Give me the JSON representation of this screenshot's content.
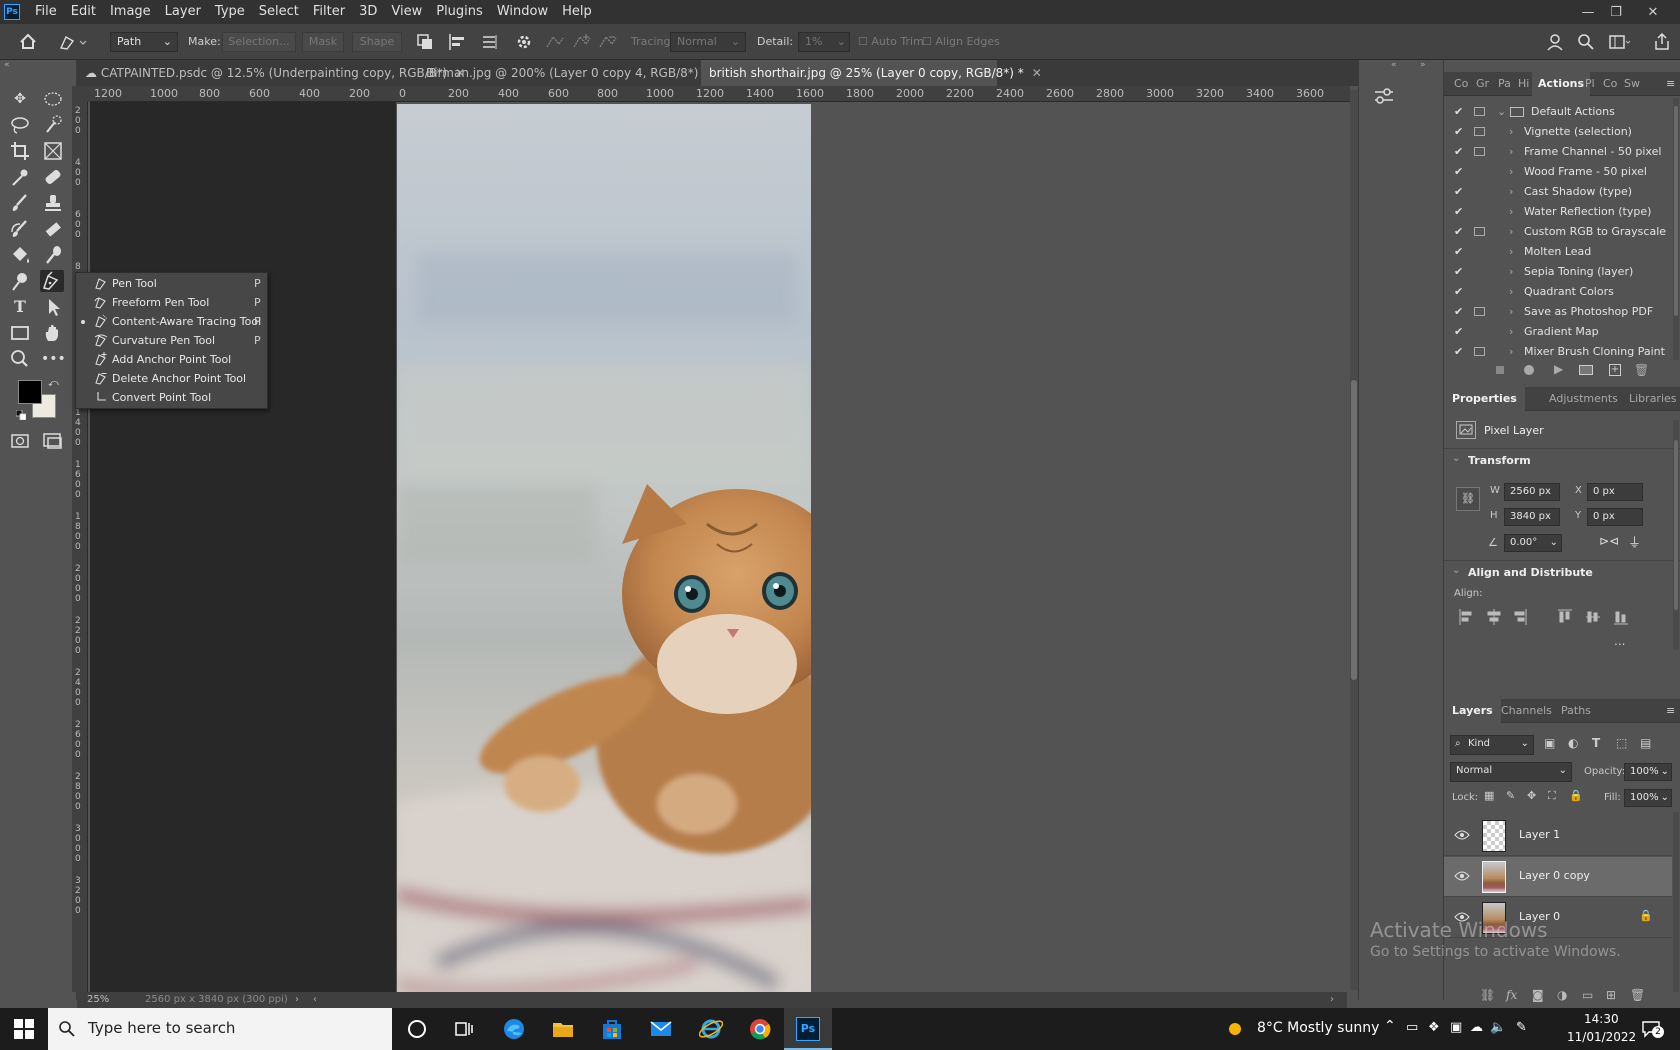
{
  "app": {
    "logo": "Ps"
  },
  "menubar": {
    "items": [
      "File",
      "Edit",
      "Image",
      "Layer",
      "Type",
      "Select",
      "Filter",
      "3D",
      "View",
      "Plugins",
      "Window",
      "Help"
    ]
  },
  "options": {
    "path_mode": "Path",
    "make_label": "Make:",
    "selection_btn": "Selection...",
    "mask_btn": "Mask",
    "shape_btn": "Shape",
    "tracing_label": "Tracing:",
    "tracing_value": "Normal",
    "detail_label": "Detail:",
    "detail_value": "1%",
    "auto_trim": "Auto Trim",
    "align_edges": "Align Edges"
  },
  "tabs": [
    {
      "label": "CATPAINTED.psdc @ 12.5% (Underpainting copy, RGB/8*)"
    },
    {
      "label": "Birman.jpg @ 200% (Layer 0 copy 4, RGB/8*) *"
    },
    {
      "label": "british shorthair.jpg @ 25% (Layer 0 copy, RGB/8*) *"
    }
  ],
  "ruler_top": [
    "1200",
    "1000",
    "800",
    "600",
    "400",
    "200",
    "0",
    "200",
    "400",
    "600",
    "800",
    "1000",
    "1200",
    "1400",
    "1600",
    "1800",
    "2000",
    "2200",
    "2400",
    "2600",
    "2800",
    "3000",
    "3200",
    "3400",
    "3600"
  ],
  "ruler_left": [
    "2",
    "0",
    "0",
    "4",
    "0",
    "0",
    "6",
    "0",
    "0",
    "8",
    "0",
    "0",
    "1",
    "0",
    "0",
    "0",
    "1",
    "2",
    "0",
    "0",
    "1",
    "4",
    "0",
    "0",
    "1",
    "6",
    "0",
    "0",
    "1",
    "8",
    "0",
    "0",
    "2",
    "0",
    "0",
    "0",
    "2",
    "2",
    "0",
    "0",
    "2",
    "4",
    "0",
    "0",
    "2",
    "6",
    "0",
    "0",
    "2",
    "8",
    "0",
    "0",
    "3",
    "0",
    "0",
    "0",
    "3",
    "2",
    "0",
    "0",
    "3",
    "4",
    "0",
    "0"
  ],
  "flyout": {
    "items": [
      {
        "label": "Pen Tool",
        "key": "P"
      },
      {
        "label": "Freeform Pen Tool",
        "key": "P"
      },
      {
        "label": "Content-Aware Tracing Tool",
        "key": "P"
      },
      {
        "label": "Curvature Pen Tool",
        "key": "P"
      },
      {
        "label": "Add Anchor Point Tool",
        "key": ""
      },
      {
        "label": "Delete Anchor Point Tool",
        "key": ""
      },
      {
        "label": "Convert Point Tool",
        "key": ""
      }
    ]
  },
  "status": {
    "zoom": "25%",
    "info": "2560 px x 3840 px (300 ppi)"
  },
  "actions_panel": {
    "tabs": [
      "Co",
      "Gr",
      "Pa",
      "Hi",
      "Actions",
      "Pl",
      "Co",
      "Sw"
    ],
    "set_name": "Default Actions",
    "items": [
      "Vignette (selection)",
      "Frame Channel - 50 pixel",
      "Wood Frame - 50 pixel",
      "Cast Shadow (type)",
      "Water Reflection (type)",
      "Custom RGB to Grayscale",
      "Molten Lead",
      "Sepia Toning (layer)",
      "Quadrant Colors",
      "Save as Photoshop PDF",
      "Gradient Map",
      "Mixer Brush Cloning Paint ..."
    ]
  },
  "properties_panel": {
    "tabs": [
      "Properties",
      "Adjustments",
      "Libraries"
    ],
    "kind": "Pixel Layer",
    "transform_title": "Transform",
    "w_label": "W",
    "w_value": "2560 px",
    "h_label": "H",
    "h_value": "3840 px",
    "x_label": "X",
    "x_value": "0 px",
    "y_label": "Y",
    "y_value": "0 px",
    "angle_value": "0.00°",
    "align_title": "Align and Distribute",
    "align_label": "Align:",
    "more": "..."
  },
  "layers_panel": {
    "tabs": [
      "Layers",
      "Channels",
      "Paths"
    ],
    "filter": "Kind",
    "blend_mode": "Normal",
    "opacity_label": "Opacity:",
    "opacity_value": "100%",
    "lock_label": "Lock:",
    "fill_label": "Fill:",
    "fill_value": "100%",
    "layers": [
      {
        "name": "Layer 1",
        "selected": false,
        "locked": false
      },
      {
        "name": "Layer 0 copy",
        "selected": true,
        "locked": false
      },
      {
        "name": "Layer 0",
        "selected": false,
        "locked": true
      }
    ]
  },
  "watermark": {
    "title": "Activate Windows",
    "subtitle": "Go to Settings to activate Windows."
  },
  "taskbar": {
    "search_placeholder": "Type here to search",
    "weather": "8°C  Mostly sunny",
    "time": "14:30",
    "date": "11/01/2022",
    "notification_count": "2"
  }
}
